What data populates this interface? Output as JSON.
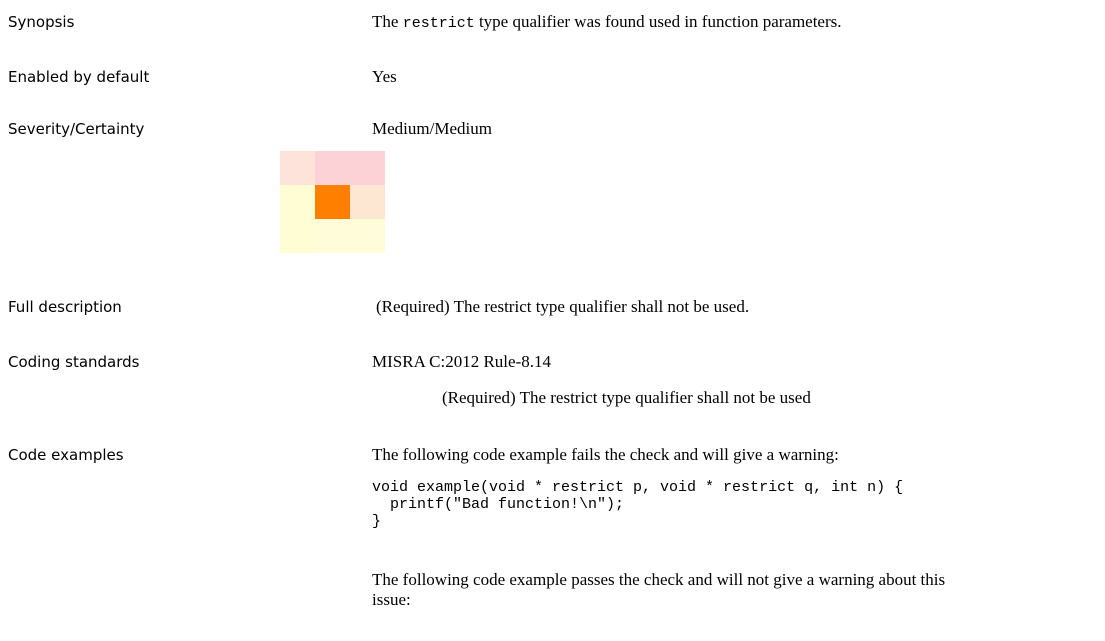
{
  "synopsis": {
    "label": "Synopsis",
    "before": "The ",
    "code": "restrict",
    "after": " type qualifier was found used in function parameters."
  },
  "enabled": {
    "label": "Enabled by default",
    "value": "Yes"
  },
  "severity": {
    "label": "Severity/Certainty",
    "value": "Medium/Medium",
    "matrix_colors": [
      "#fde3da",
      "#fdd2d6",
      "#fdd2d6",
      "#fffdd3",
      "#ff8000",
      "#fde7d3",
      "#fffdd3",
      "#fffdd9",
      "#fffdd9"
    ],
    "selected_cell": "Medium/Medium"
  },
  "full_description": {
    "label": "Full description",
    "value": "(Required) The restrict type qualifier shall not be used."
  },
  "coding_standards": {
    "label": "Coding standards",
    "standard": "MISRA C:2012 Rule-8.14",
    "detail": "(Required) The restrict type qualifier shall not be used"
  },
  "code_examples": {
    "label": "Code examples",
    "fail_intro": "The following code example fails the check and will give a warning:",
    "fail_code": "void example(void * restrict p, void * restrict q, int n) {\n  printf(\"Bad function!\\n\");\n}",
    "pass_intro_line1": "The following code example passes the check and will not give a warning about this",
    "pass_intro_line2": "issue:"
  }
}
